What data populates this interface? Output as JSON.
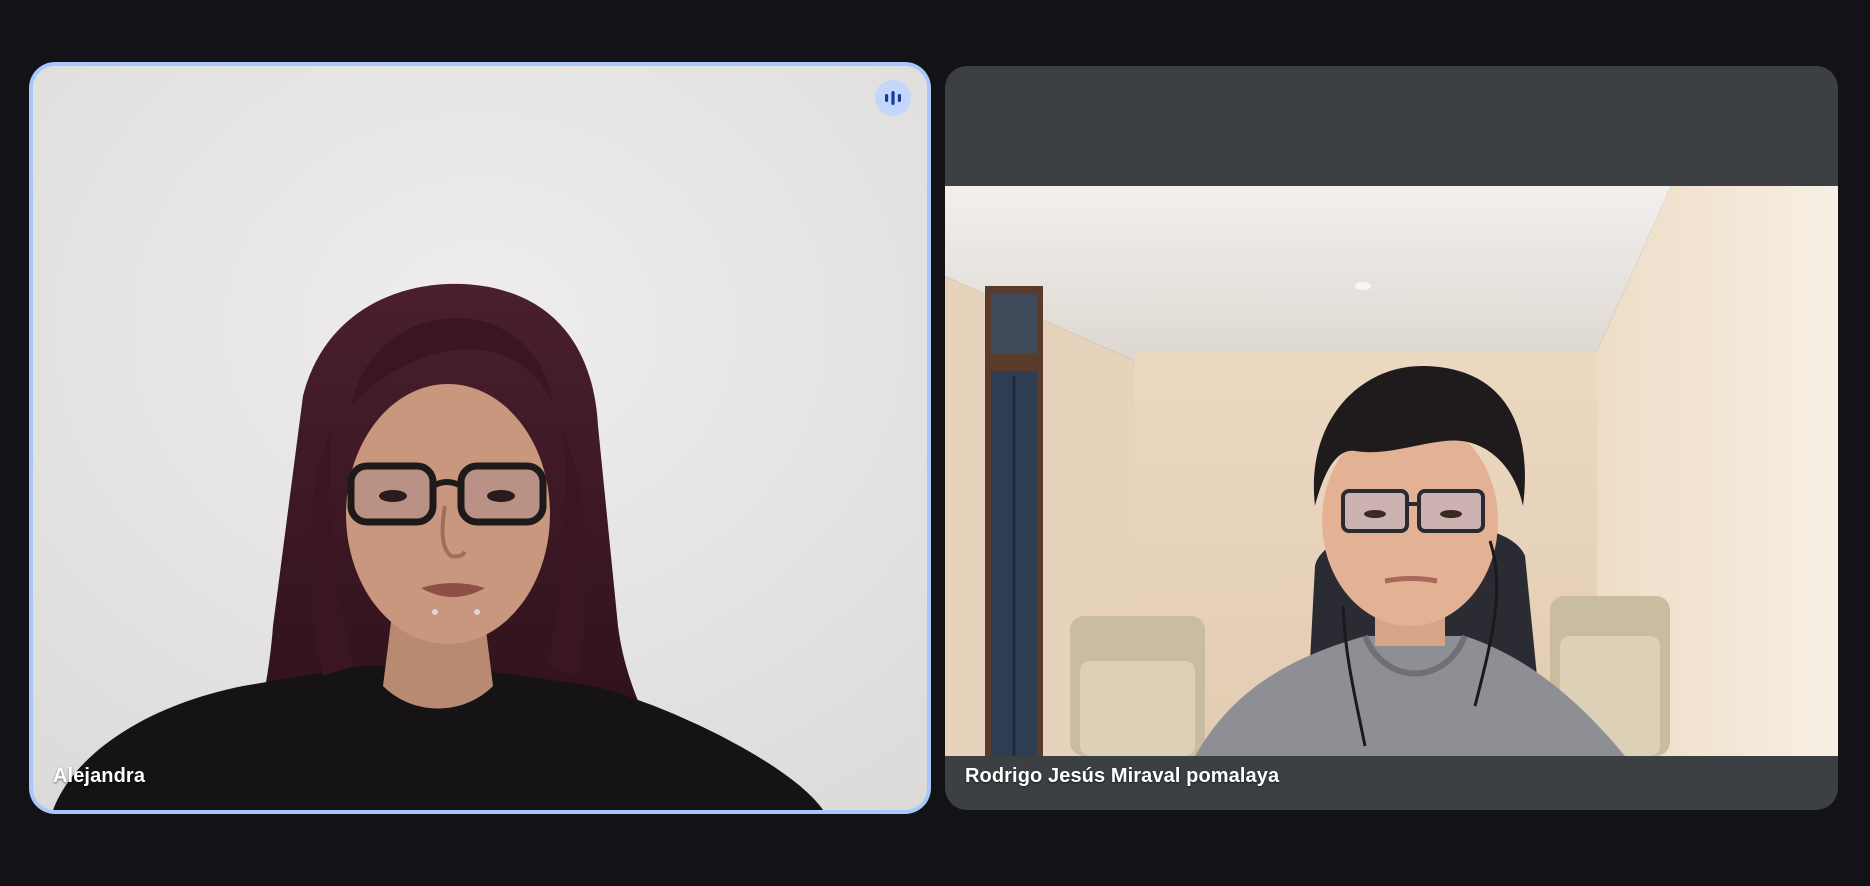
{
  "meeting": {
    "participants": [
      {
        "name": "Alejandra",
        "is_speaking": true,
        "speaking_icon": "audio-level-icon",
        "tile_highlight_color": "#a8c7fa"
      },
      {
        "name": "Rodrigo Jesús Miraval pomalaya",
        "is_speaking": false
      }
    ]
  },
  "colors": {
    "background": "#131217",
    "tile_background": "#3c4043",
    "speaking_badge": "#c2d7fb",
    "speaking_bars": "#1a3a8f"
  }
}
